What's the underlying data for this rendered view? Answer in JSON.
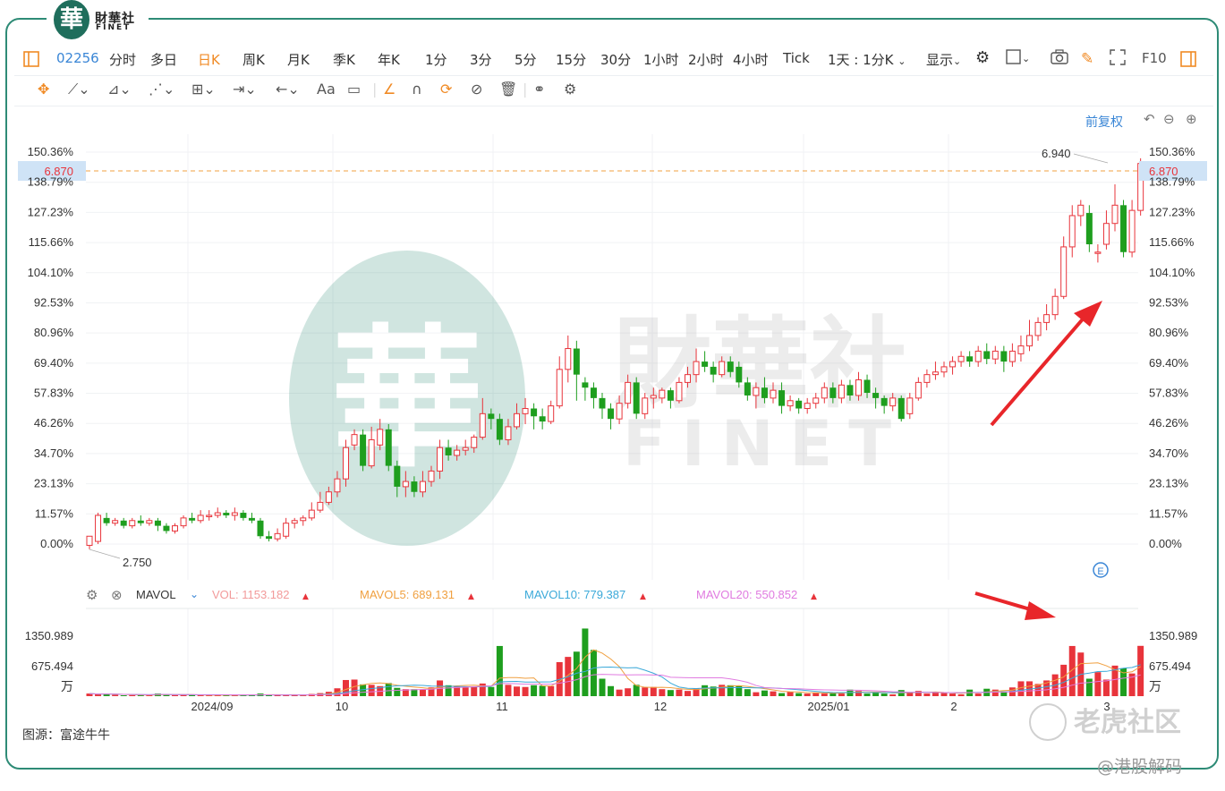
{
  "brand": {
    "cn": "財華社",
    "en": "FINET",
    "glyph": "華"
  },
  "toolbar": {
    "code": "02256",
    "periods": [
      "分时",
      "多日",
      "日K",
      "周K",
      "月K",
      "季K",
      "年K",
      "1分",
      "3分",
      "5分",
      "15分",
      "30分",
      "1小时",
      "2小时",
      "4小时",
      "Tick"
    ],
    "active_period": "日K",
    "interval_select": "1天 : 1分K",
    "display_select": "显示",
    "f10": "F10"
  },
  "adjust_label": "前复权",
  "price_axis": {
    "ticks": [
      "150.36%",
      "138.79%",
      "127.23%",
      "115.66%",
      "104.10%",
      "92.53%",
      "80.96%",
      "69.40%",
      "57.83%",
      "46.26%",
      "34.70%",
      "23.13%",
      "11.57%",
      "0.00%"
    ],
    "current_price": "6.870",
    "high_label": "6.940",
    "low_label": "2.750"
  },
  "volume_panel": {
    "indicator": "MAVOL",
    "vol": "VOL: 1153.182",
    "mavol5": "MAVOL5: 689.131",
    "mavol10": "MAVOL10: 779.387",
    "mavol20": "MAVOL20: 550.852",
    "ticks": [
      "1350.989",
      "675.494"
    ],
    "unit": "万"
  },
  "x_axis": {
    "labels": [
      "2024/09",
      "10",
      "11",
      "12",
      "2025/01",
      "2",
      "3"
    ]
  },
  "source": "图源：富途牛牛",
  "watermarks": {
    "tiger": "老虎社区",
    "author": "@港股解码"
  },
  "colors": {
    "up": "#e8343b",
    "down": "#1e9e1e",
    "accent": "#f08a24",
    "link": "#3a86d6",
    "frame": "#2e8b76"
  },
  "chart_data": {
    "type": "candlestick",
    "y_scale": {
      "base": 2.75,
      "top_pct": 150.36
    },
    "x_labels": [
      "2024/09",
      "10",
      "11",
      "12",
      "2025/01",
      "2",
      "3"
    ],
    "candles": [
      [
        0,
        -0.5,
        3,
        -2,
        1
      ],
      [
        1,
        1,
        11,
        0,
        12
      ],
      [
        2,
        10,
        8,
        7,
        12
      ],
      [
        3,
        8,
        9,
        7,
        10
      ],
      [
        4,
        9,
        7,
        6,
        10
      ],
      [
        5,
        7,
        9,
        6,
        10
      ],
      [
        6,
        9,
        8,
        7,
        11
      ],
      [
        7,
        8,
        9,
        7,
        10
      ],
      [
        8,
        9,
        7,
        5,
        10
      ],
      [
        9,
        7,
        5,
        4,
        8
      ],
      [
        10,
        5,
        7,
        4,
        8
      ],
      [
        11,
        7,
        10,
        6,
        11
      ],
      [
        12,
        10,
        9,
        8,
        12
      ],
      [
        13,
        9,
        11,
        8,
        13
      ],
      [
        14,
        11,
        11,
        9,
        13
      ],
      [
        15,
        11,
        12,
        10,
        14
      ],
      [
        16,
        12,
        11,
        10,
        13
      ],
      [
        17,
        11,
        12,
        9,
        14
      ],
      [
        18,
        12,
        10,
        9,
        13
      ],
      [
        19,
        10,
        9,
        8,
        12
      ],
      [
        20,
        9,
        3,
        2,
        10
      ],
      [
        21,
        3,
        2,
        1,
        5
      ],
      [
        22,
        2,
        4,
        1,
        6
      ],
      [
        23,
        3,
        8,
        2,
        10
      ],
      [
        24,
        8,
        9,
        6,
        10
      ],
      [
        25,
        9,
        10,
        7,
        11
      ],
      [
        26,
        10,
        13,
        9,
        16
      ],
      [
        27,
        13,
        16,
        12,
        20
      ],
      [
        28,
        16,
        20,
        15,
        22
      ],
      [
        29,
        20,
        25,
        18,
        28
      ],
      [
        30,
        25,
        37,
        22,
        40
      ],
      [
        31,
        38,
        42,
        36,
        44
      ],
      [
        32,
        42,
        30,
        28,
        44
      ],
      [
        33,
        30,
        40,
        29,
        45
      ],
      [
        34,
        38,
        44,
        36,
        48
      ],
      [
        35,
        44,
        30,
        28,
        46
      ],
      [
        36,
        30,
        22,
        18,
        32
      ],
      [
        37,
        22,
        24,
        18,
        28
      ],
      [
        38,
        24,
        20,
        18,
        26
      ],
      [
        39,
        20,
        24,
        18,
        28
      ],
      [
        40,
        24,
        28,
        22,
        30
      ],
      [
        41,
        28,
        37,
        25,
        40
      ],
      [
        42,
        37,
        34,
        32,
        40
      ],
      [
        43,
        34,
        36,
        32,
        38
      ],
      [
        44,
        36,
        37,
        34,
        40
      ],
      [
        45,
        37,
        41,
        35,
        42
      ],
      [
        46,
        41,
        50,
        40,
        56
      ],
      [
        47,
        50,
        48,
        44,
        52
      ],
      [
        48,
        48,
        40,
        38,
        50
      ],
      [
        49,
        40,
        45,
        38,
        48
      ],
      [
        50,
        45,
        50,
        44,
        54
      ],
      [
        51,
        50,
        52,
        46,
        56
      ],
      [
        52,
        52,
        49,
        44,
        54
      ],
      [
        53,
        49,
        47,
        44,
        52
      ],
      [
        54,
        47,
        53,
        46,
        55
      ],
      [
        55,
        53,
        67,
        52,
        72
      ],
      [
        56,
        67,
        75,
        62,
        80
      ],
      [
        57,
        75,
        65,
        55,
        78
      ],
      [
        58,
        62,
        60,
        55,
        64
      ],
      [
        59,
        60,
        56,
        52,
        62
      ],
      [
        60,
        56,
        52,
        48,
        58
      ],
      [
        61,
        52,
        48,
        44,
        54
      ],
      [
        62,
        48,
        54,
        46,
        57
      ],
      [
        63,
        54,
        62,
        52,
        65
      ],
      [
        64,
        62,
        50,
        48,
        64
      ],
      [
        65,
        50,
        56,
        48,
        58
      ],
      [
        66,
        56,
        57,
        52,
        60
      ],
      [
        67,
        56,
        59,
        54,
        60
      ],
      [
        68,
        59,
        55,
        52,
        60
      ],
      [
        69,
        55,
        62,
        54,
        64
      ],
      [
        70,
        62,
        65,
        60,
        68
      ],
      [
        71,
        65,
        70,
        62,
        75
      ],
      [
        72,
        70,
        68,
        66,
        74
      ],
      [
        73,
        68,
        65,
        62,
        70
      ],
      [
        74,
        65,
        70,
        64,
        72
      ],
      [
        75,
        70,
        66,
        64,
        72
      ],
      [
        76,
        68,
        62,
        60,
        70
      ],
      [
        77,
        62,
        57,
        55,
        64
      ],
      [
        78,
        57,
        60,
        52,
        62
      ],
      [
        79,
        60,
        56,
        54,
        64
      ],
      [
        80,
        56,
        59,
        54,
        62
      ],
      [
        81,
        59,
        53,
        50,
        62
      ],
      [
        82,
        53,
        55,
        51,
        57
      ],
      [
        83,
        55,
        52,
        50,
        56
      ],
      [
        84,
        52,
        54,
        50,
        56
      ],
      [
        85,
        54,
        56,
        52,
        58
      ],
      [
        86,
        56,
        60,
        54,
        62
      ],
      [
        87,
        60,
        56,
        54,
        62
      ],
      [
        88,
        56,
        61,
        54,
        63
      ],
      [
        89,
        61,
        57,
        55,
        63
      ],
      [
        90,
        57,
        63,
        55,
        66
      ],
      [
        91,
        63,
        58,
        56,
        65
      ],
      [
        92,
        58,
        56,
        52,
        60
      ],
      [
        93,
        56,
        53,
        50,
        57
      ],
      [
        94,
        53,
        56,
        51,
        58
      ],
      [
        95,
        56,
        48,
        47,
        57
      ],
      [
        96,
        50,
        56,
        48,
        58
      ],
      [
        97,
        56,
        62,
        55,
        64
      ],
      [
        98,
        62,
        65,
        60,
        67
      ],
      [
        99,
        65,
        66,
        63,
        70
      ],
      [
        100,
        66,
        68,
        64,
        70
      ],
      [
        101,
        68,
        70,
        65,
        72
      ],
      [
        102,
        70,
        72,
        68,
        74
      ],
      [
        103,
        72,
        70,
        68,
        74
      ],
      [
        104,
        70,
        74,
        68,
        76
      ],
      [
        105,
        74,
        71,
        69,
        77
      ],
      [
        106,
        71,
        74,
        69,
        76
      ],
      [
        107,
        74,
        70,
        66,
        76
      ],
      [
        108,
        70,
        74,
        68,
        77
      ],
      [
        109,
        73,
        76,
        70,
        80
      ],
      [
        110,
        76,
        80,
        74,
        86
      ],
      [
        111,
        80,
        85,
        78,
        87
      ],
      [
        112,
        85,
        88,
        82,
        92
      ],
      [
        113,
        88,
        95,
        86,
        98
      ],
      [
        114,
        95,
        114,
        94,
        118
      ],
      [
        115,
        114,
        126,
        110,
        130
      ],
      [
        116,
        126,
        130,
        122,
        132
      ],
      [
        117,
        127,
        115,
        112,
        130
      ],
      [
        118,
        112,
        112,
        108,
        115
      ],
      [
        119,
        115,
        123,
        113,
        128
      ],
      [
        120,
        123,
        130,
        120,
        138
      ],
      [
        121,
        130,
        112,
        110,
        132
      ],
      [
        122,
        112,
        128,
        110,
        132
      ],
      [
        123,
        128,
        146,
        126,
        148
      ]
    ],
    "volume": [
      [
        0,
        60
      ],
      [
        1,
        40
      ],
      [
        2,
        50
      ],
      [
        3,
        30
      ],
      [
        4,
        20
      ],
      [
        5,
        25
      ],
      [
        6,
        20
      ],
      [
        7,
        30
      ],
      [
        8,
        60
      ],
      [
        9,
        40
      ],
      [
        10,
        25
      ],
      [
        11,
        30
      ],
      [
        12,
        25
      ],
      [
        13,
        20
      ],
      [
        14,
        20
      ],
      [
        15,
        25
      ],
      [
        16,
        20
      ],
      [
        17,
        25
      ],
      [
        18,
        30
      ],
      [
        19,
        25
      ],
      [
        20,
        60
      ],
      [
        21,
        30
      ],
      [
        22,
        25
      ],
      [
        23,
        20
      ],
      [
        24,
        30
      ],
      [
        25,
        25
      ],
      [
        26,
        50
      ],
      [
        27,
        70
      ],
      [
        28,
        100
      ],
      [
        29,
        180
      ],
      [
        30,
        370
      ],
      [
        31,
        380
      ],
      [
        32,
        270
      ],
      [
        33,
        260
      ],
      [
        34,
        230
      ],
      [
        35,
        300
      ],
      [
        36,
        190
      ],
      [
        37,
        160
      ],
      [
        38,
        160
      ],
      [
        39,
        150
      ],
      [
        40,
        200
      ],
      [
        41,
        360
      ],
      [
        42,
        250
      ],
      [
        43,
        220
      ],
      [
        44,
        200
      ],
      [
        45,
        220
      ],
      [
        46,
        290
      ],
      [
        47,
        210
      ],
      [
        48,
        1150
      ],
      [
        49,
        260
      ],
      [
        50,
        220
      ],
      [
        51,
        210
      ],
      [
        52,
        250
      ],
      [
        53,
        240
      ],
      [
        54,
        230
      ],
      [
        55,
        780
      ],
      [
        56,
        900
      ],
      [
        57,
        1020
      ],
      [
        58,
        1550
      ],
      [
        59,
        1060
      ],
      [
        60,
        400
      ],
      [
        61,
        230
      ],
      [
        62,
        150
      ],
      [
        63,
        180
      ],
      [
        64,
        260
      ],
      [
        65,
        200
      ],
      [
        66,
        210
      ],
      [
        67,
        160
      ],
      [
        68,
        140
      ],
      [
        69,
        150
      ],
      [
        70,
        120
      ],
      [
        71,
        180
      ],
      [
        72,
        250
      ],
      [
        73,
        220
      ],
      [
        74,
        260
      ],
      [
        75,
        250
      ],
      [
        76,
        230
      ],
      [
        77,
        160
      ],
      [
        78,
        90
      ],
      [
        79,
        130
      ],
      [
        80,
        110
      ],
      [
        81,
        70
      ],
      [
        82,
        100
      ],
      [
        83,
        70
      ],
      [
        84,
        60
      ],
      [
        85,
        80
      ],
      [
        86,
        60
      ],
      [
        87,
        80
      ],
      [
        88,
        60
      ],
      [
        89,
        150
      ],
      [
        90,
        120
      ],
      [
        91,
        60
      ],
      [
        92,
        80
      ],
      [
        93,
        60
      ],
      [
        94,
        40
      ],
      [
        95,
        140
      ],
      [
        96,
        80
      ],
      [
        97,
        120
      ],
      [
        98,
        60
      ],
      [
        99,
        90
      ],
      [
        100,
        70
      ],
      [
        101,
        60
      ],
      [
        102,
        40
      ],
      [
        103,
        150
      ],
      [
        104,
        60
      ],
      [
        105,
        170
      ],
      [
        106,
        150
      ],
      [
        107,
        110
      ],
      [
        108,
        200
      ],
      [
        109,
        340
      ],
      [
        110,
        340
      ],
      [
        111,
        280
      ],
      [
        112,
        360
      ],
      [
        113,
        500
      ],
      [
        114,
        720
      ],
      [
        115,
        1150
      ],
      [
        116,
        1000
      ],
      [
        117,
        400
      ],
      [
        118,
        550
      ],
      [
        119,
        380
      ],
      [
        120,
        700
      ],
      [
        121,
        640
      ],
      [
        122,
        520
      ],
      [
        123,
        1153
      ]
    ]
  }
}
